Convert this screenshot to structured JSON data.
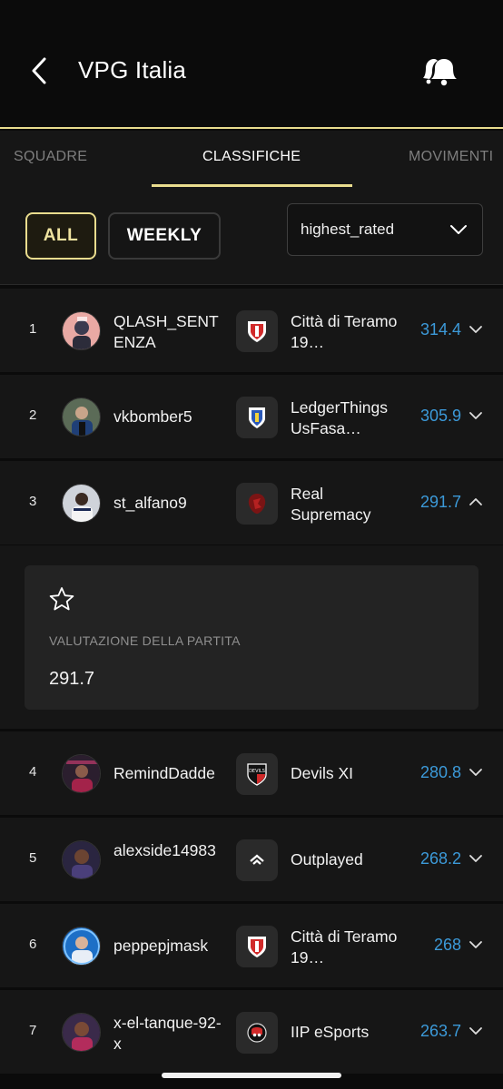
{
  "header": {
    "title": "VPG Italia",
    "back_icon": "chevron-left-icon",
    "notification_icon": "bell-icon"
  },
  "tabs": [
    {
      "label": "SQUADRE",
      "active": false
    },
    {
      "label": "CLASSIFICHE",
      "active": true
    },
    {
      "label": "MOVIMENTI",
      "active": false
    }
  ],
  "filters": {
    "all_label": "ALL",
    "weekly_label": "WEEKLY",
    "sort_value": "highest_rated",
    "selected": "ALL"
  },
  "colors": {
    "accent": "#e9dc8e",
    "rating": "#3c9ad9",
    "background": "#0b0b0b",
    "row": "#161616"
  },
  "rows": [
    {
      "rank": "1",
      "username": "QLASH_SENTENZA",
      "club": "Città di Teramo 19…",
      "rating": "314.4",
      "expanded": false
    },
    {
      "rank": "2",
      "username": "vkbomber5",
      "club": "LedgerThings UsFasa…",
      "rating": "305.9",
      "expanded": false
    },
    {
      "rank": "3",
      "username": "st_alfano9",
      "club": "Real Supremacy",
      "rating": "291.7",
      "expanded": true
    },
    {
      "rank": "4",
      "username": "RemindDadde",
      "club": "Devils XI",
      "rating": "280.8",
      "expanded": false
    },
    {
      "rank": "5",
      "username": "alexside14983",
      "club": "Outplayed",
      "rating": "268.2",
      "expanded": false
    },
    {
      "rank": "6",
      "username": "peppepjmask",
      "club": "Città di Teramo 19…",
      "rating": "268",
      "expanded": false
    },
    {
      "rank": "7",
      "username": "x-el-tanque-92-x",
      "club": "IIP eSports",
      "rating": "263.7",
      "expanded": false
    }
  ],
  "detail": {
    "label": "VALUTAZIONE DELLA PARTITA",
    "value": "291.7",
    "star_icon": "star-outline-icon"
  }
}
